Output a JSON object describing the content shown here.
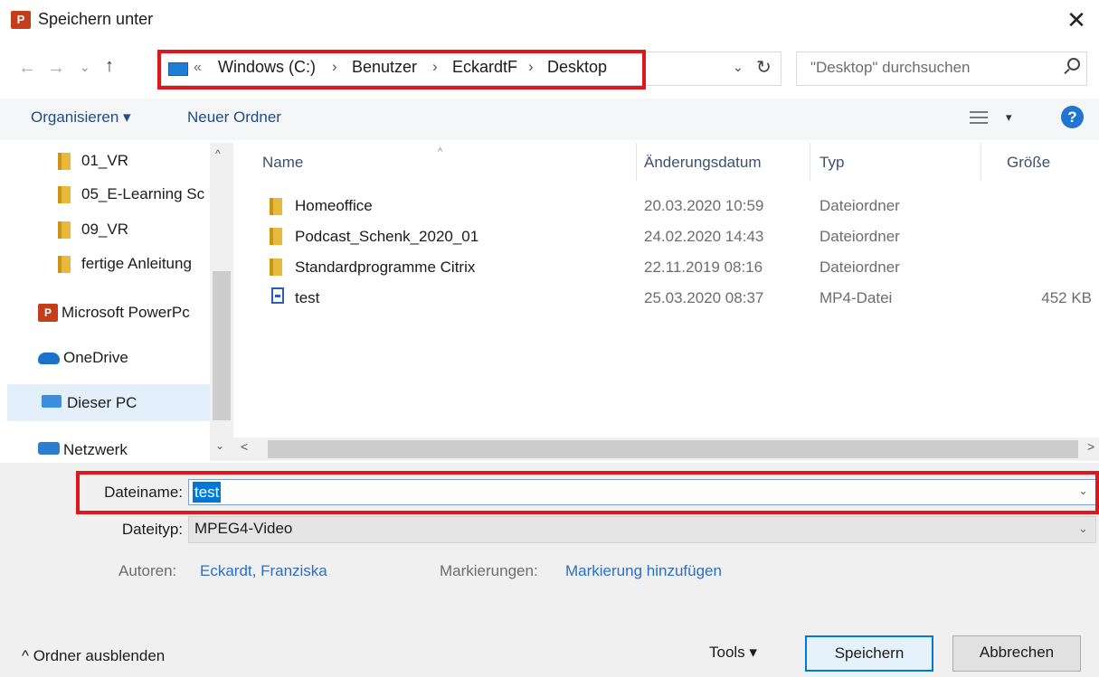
{
  "window": {
    "title": "Speichern unter",
    "app_icon_text": "P",
    "close_glyph": "✕"
  },
  "nav": {
    "back_glyph": "←",
    "forward_glyph": "→",
    "recent_glyph": "⌄",
    "up_glyph": "↑",
    "address": {
      "overflow_glyph": "«",
      "crumbs": [
        "Windows (C:)",
        "Benutzer",
        "EckardtF",
        "Desktop"
      ],
      "separator": "›",
      "dropdown_glyph": "⌄",
      "refresh_glyph": "↻"
    },
    "search": {
      "placeholder": "\"Desktop\" durchsuchen"
    }
  },
  "toolbar": {
    "organize_label": "Organisieren ▾",
    "new_folder_label": "Neuer Ordner",
    "view_dropdown_glyph": "▾",
    "help_glyph": "?"
  },
  "sidebar": {
    "items": [
      {
        "label": "01_VR",
        "icon": "folder-icon"
      },
      {
        "label": "05_E-Learning Sc",
        "icon": "folder-icon"
      },
      {
        "label": "09_VR",
        "icon": "folder-icon"
      },
      {
        "label": "fertige Anleitung",
        "icon": "folder-icon"
      },
      {
        "label": "Microsoft PowerPc",
        "icon": "powerpoint-icon"
      },
      {
        "label": "OneDrive",
        "icon": "cloud-icon"
      },
      {
        "label": "Dieser PC",
        "icon": "computer-icon"
      },
      {
        "label": "Netzwerk",
        "icon": "network-icon"
      }
    ],
    "scroll_up_glyph": "^",
    "scroll_down_glyph": "⌄"
  },
  "file_list": {
    "columns": [
      "Name",
      "Änderungsdatum",
      "Typ",
      "Größe"
    ],
    "sort_glyph": "^",
    "rows": [
      {
        "name": "Homeoffice",
        "date": "20.03.2020 10:59",
        "type": "Dateiordner",
        "size": "",
        "icon": "folder-icon"
      },
      {
        "name": "Podcast_Schenk_2020_01",
        "date": "24.02.2020 14:43",
        "type": "Dateiordner",
        "size": "",
        "icon": "folder-icon"
      },
      {
        "name": "Standardprogramme Citrix",
        "date": "22.11.2019 08:16",
        "type": "Dateiordner",
        "size": "",
        "icon": "folder-icon"
      },
      {
        "name": "test",
        "date": "25.03.2020 08:37",
        "type": "MP4-Datei",
        "size": "452 KB",
        "icon": "file-icon"
      }
    ],
    "scroll_left_glyph": "<",
    "scroll_right_glyph": ">"
  },
  "save_form": {
    "filename_label": "Dateiname:",
    "filename_value": "test",
    "filetype_label": "Dateityp:",
    "filetype_value": "MPEG4-Video",
    "dropdown_glyph": "⌄",
    "authors_label": "Autoren:",
    "authors_value": "Eckardt, Franziska",
    "tags_label": "Markierungen:",
    "tags_value": "Markierung hinzufügen"
  },
  "footer": {
    "hide_folders_label": "^  Ordner ausblenden",
    "tools_label": "Tools  ▾",
    "save_label": "Speichern",
    "cancel_label": "Abbrechen"
  },
  "colors": {
    "accent": "#0078d7",
    "highlight_box": "#e0161c",
    "link": "#2a6fc4",
    "powerpoint": "#c43e1c"
  }
}
